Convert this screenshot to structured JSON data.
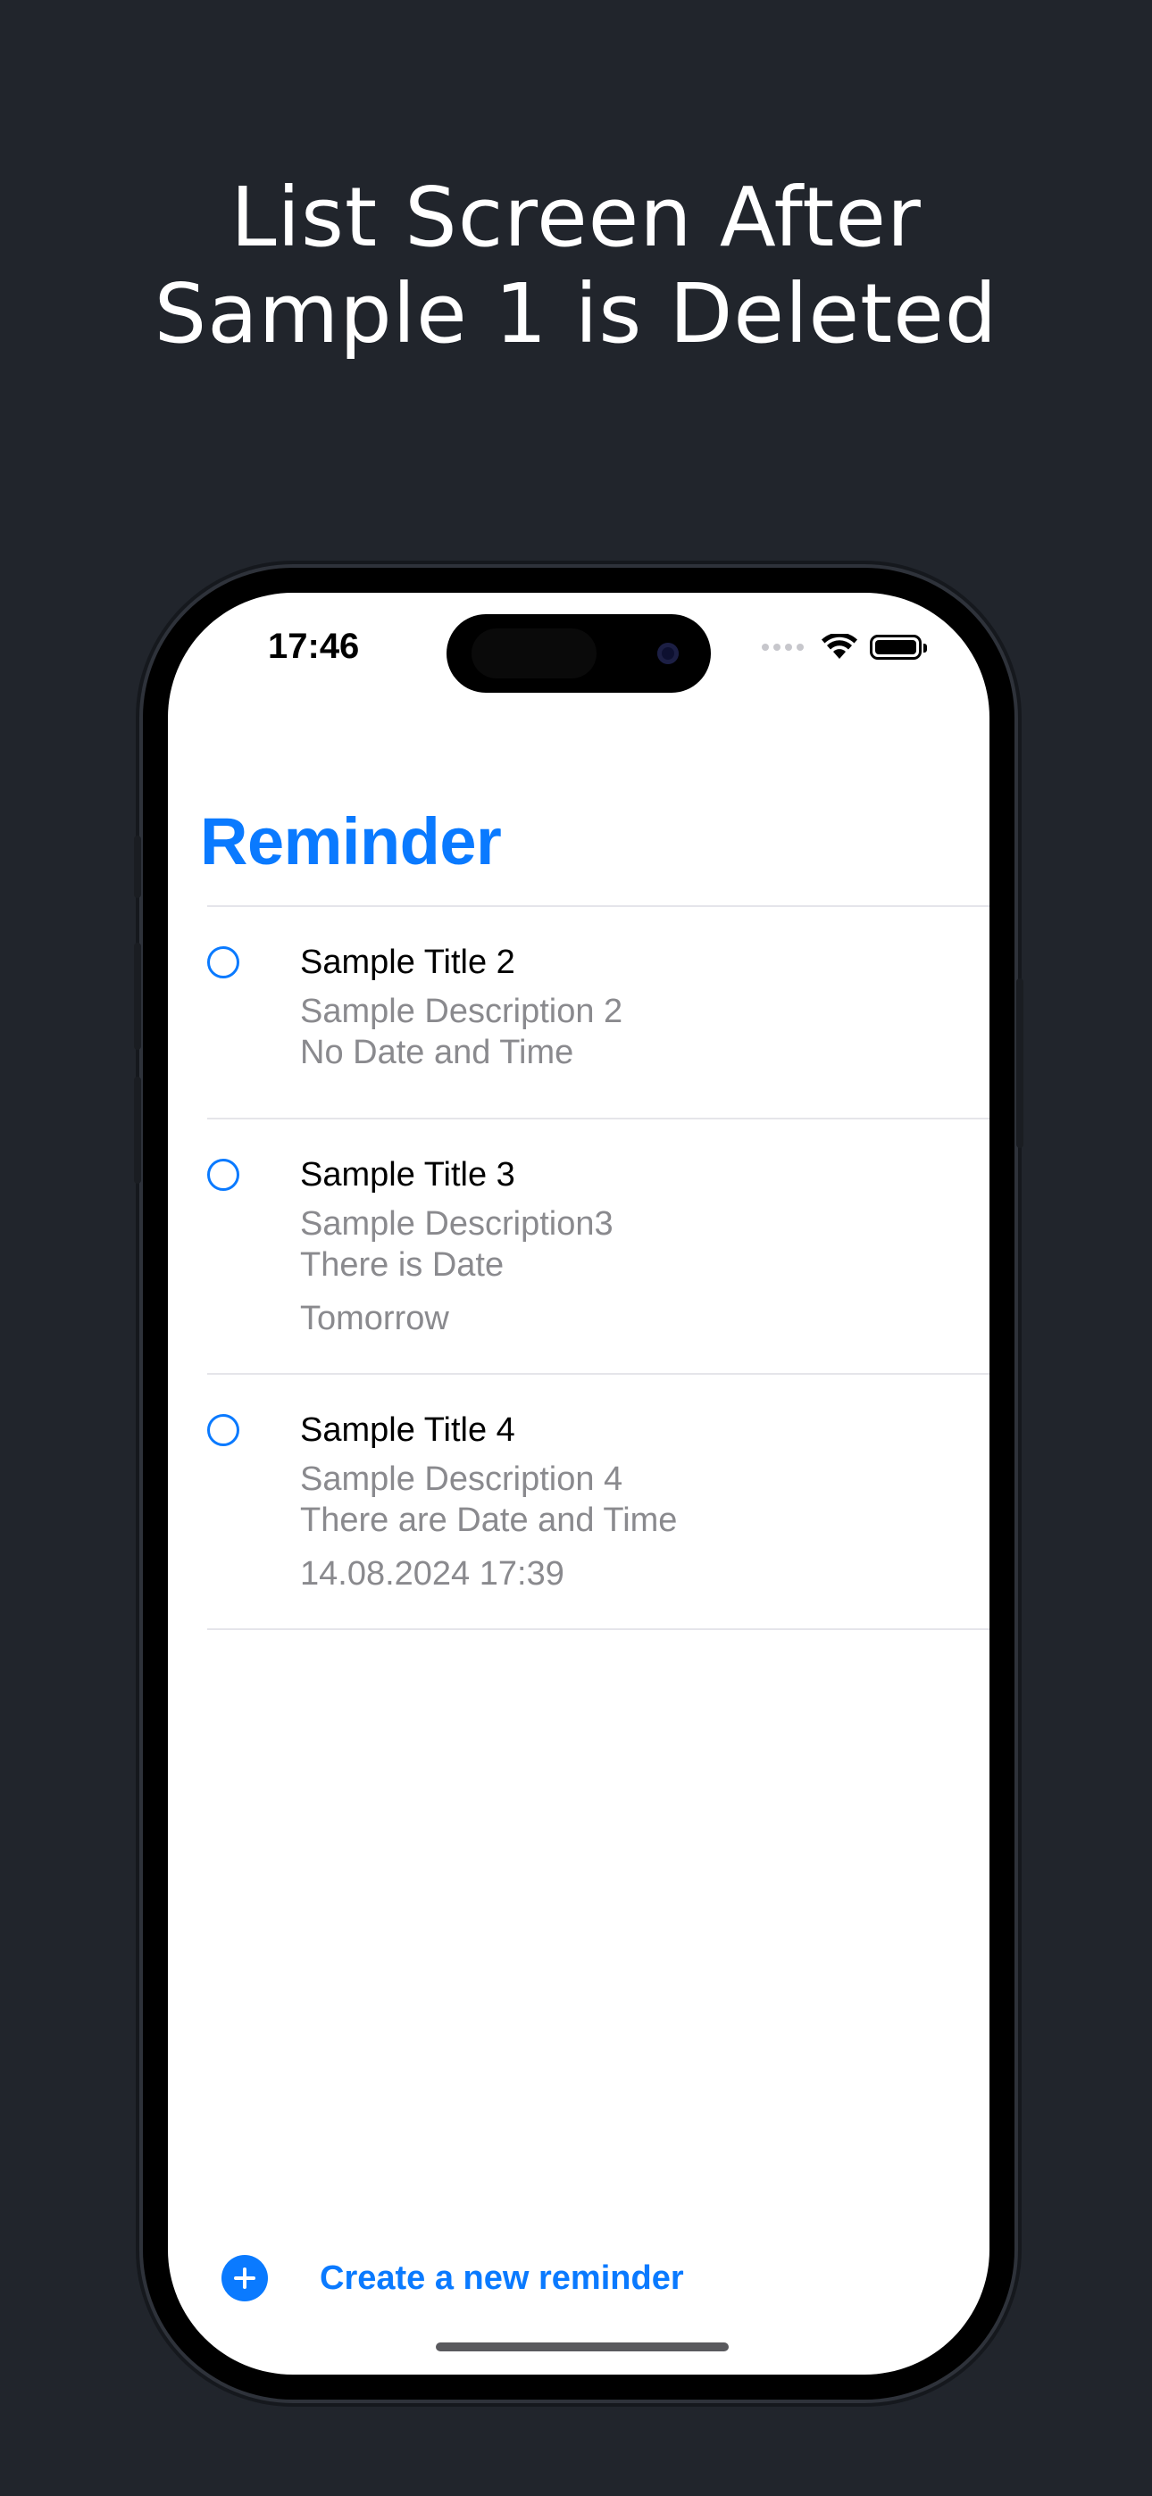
{
  "headline": {
    "line1": "List Screen After",
    "line2": "Sample 1 is Deleted"
  },
  "status_bar": {
    "time": "17:46",
    "icons": [
      "signal-dots-icon",
      "wifi-icon",
      "battery-icon"
    ]
  },
  "nav": {
    "title": "Reminder"
  },
  "reminders": [
    {
      "title": "Sample Title 2",
      "description": "Sample Description 2",
      "note": "No Date and Time",
      "when": ""
    },
    {
      "title": "Sample Title 3",
      "description": "Sample Description3",
      "note": "There is Date",
      "when": "Tomorrow"
    },
    {
      "title": "Sample Title 4",
      "description": "Sample Description 4",
      "note": "There are Date and Time",
      "when": "14.08.2024 17:39"
    }
  ],
  "footer": {
    "create_label": "Create a new reminder",
    "icon": "plus-circle-icon"
  },
  "colors": {
    "background": "#21252c",
    "accent": "#0a7aff",
    "secondary_text": "#8a8a8e",
    "separator": "#e5e5ea"
  }
}
